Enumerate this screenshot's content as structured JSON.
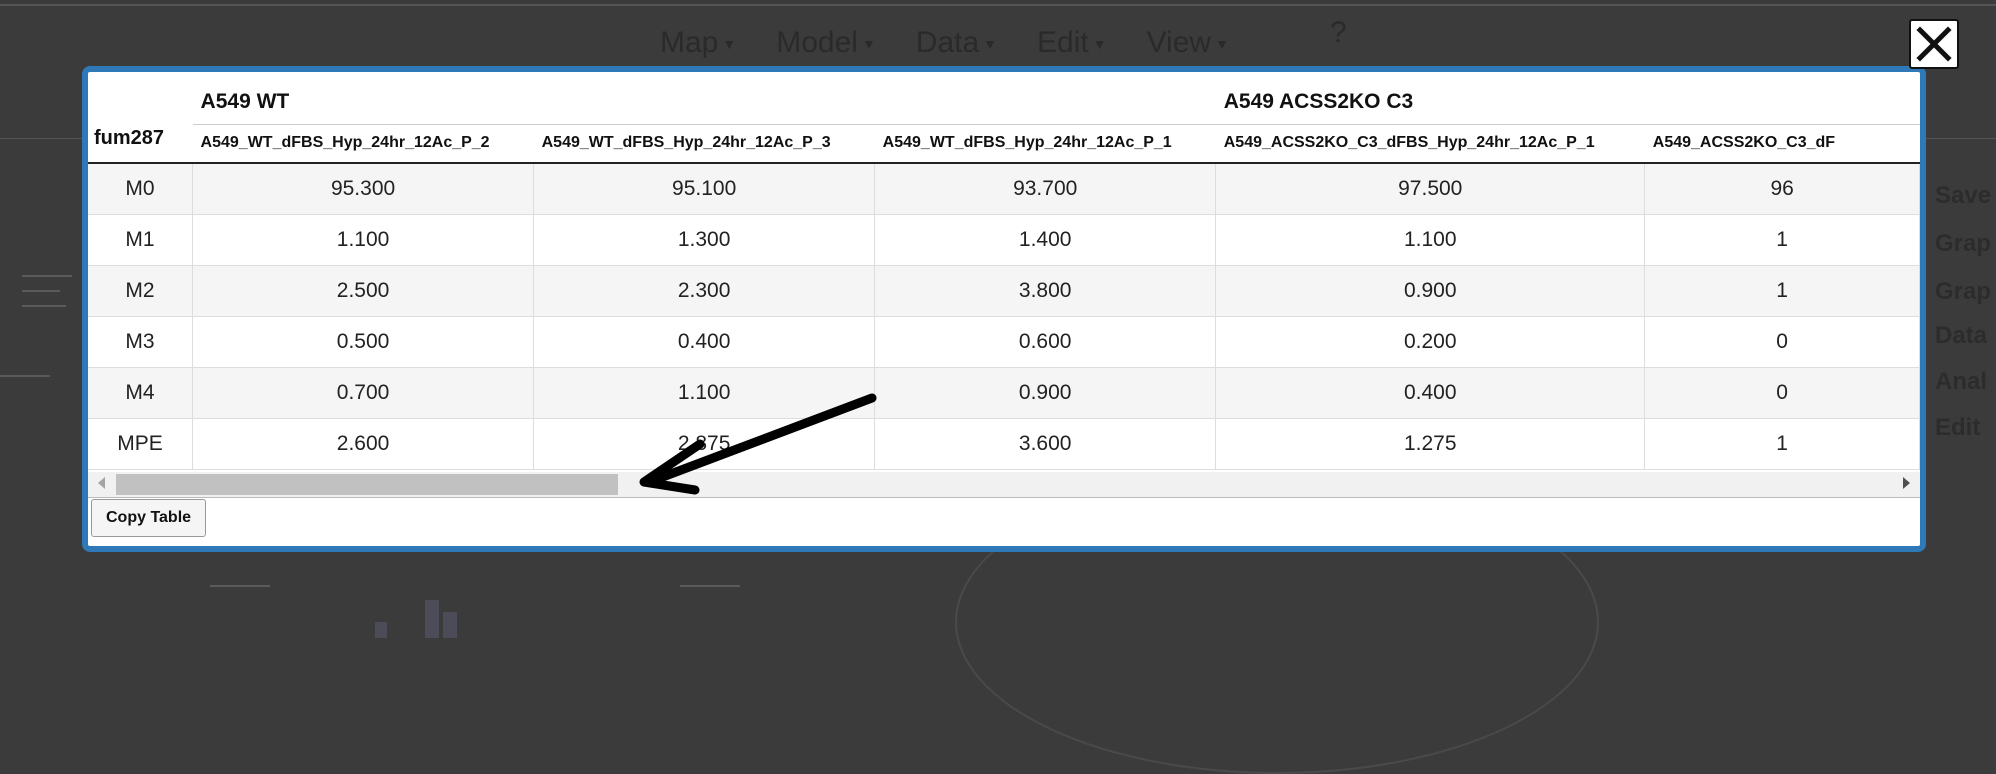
{
  "background": {
    "menu": [
      {
        "label": "Map"
      },
      {
        "label": "Model"
      },
      {
        "label": "Data"
      },
      {
        "label": "Edit"
      },
      {
        "label": "View"
      }
    ],
    "help": "?",
    "side_menu": [
      "Save",
      "Grap",
      "Grap",
      "Data",
      "Anal",
      "Edit"
    ]
  },
  "modal": {
    "groups": [
      {
        "label": "A549 WT"
      },
      {
        "label": "A549 ACSS2KO C3"
      }
    ],
    "metabolite": "fum287",
    "columns": [
      "A549_WT_dFBS_Hyp_24hr_12Ac_P_2",
      "A549_WT_dFBS_Hyp_24hr_12Ac_P_3",
      "A549_WT_dFBS_Hyp_24hr_12Ac_P_1",
      "A549_ACSS2KO_C3_dFBS_Hyp_24hr_12Ac_P_1",
      "A549_ACSS2KO_C3_dF"
    ],
    "rows": [
      {
        "label": "M0",
        "values": [
          "95.300",
          "95.100",
          "93.700",
          "97.500",
          "96"
        ]
      },
      {
        "label": "M1",
        "values": [
          "1.100",
          "1.300",
          "1.400",
          "1.100",
          "1"
        ]
      },
      {
        "label": "M2",
        "values": [
          "2.500",
          "2.300",
          "3.800",
          "0.900",
          "1"
        ]
      },
      {
        "label": "M3",
        "values": [
          "0.500",
          "0.400",
          "0.600",
          "0.200",
          "0"
        ]
      },
      {
        "label": "M4",
        "values": [
          "0.700",
          "1.100",
          "0.900",
          "0.400",
          "0"
        ]
      },
      {
        "label": "MPE",
        "values": [
          "2.600",
          "2.875",
          "3.600",
          "1.275",
          "1"
        ]
      }
    ],
    "copy_button": "Copy Table",
    "scroll_position": 0.0
  },
  "colors": {
    "modal_border": "#3079b8",
    "backdrop": "#3b3b3b",
    "annotation_arrow": "#000000"
  },
  "icons": {
    "close": "close-icon",
    "scroll_left": "chevron-left-icon",
    "scroll_right": "chevron-right-icon",
    "annotation": "arrow-icon"
  }
}
